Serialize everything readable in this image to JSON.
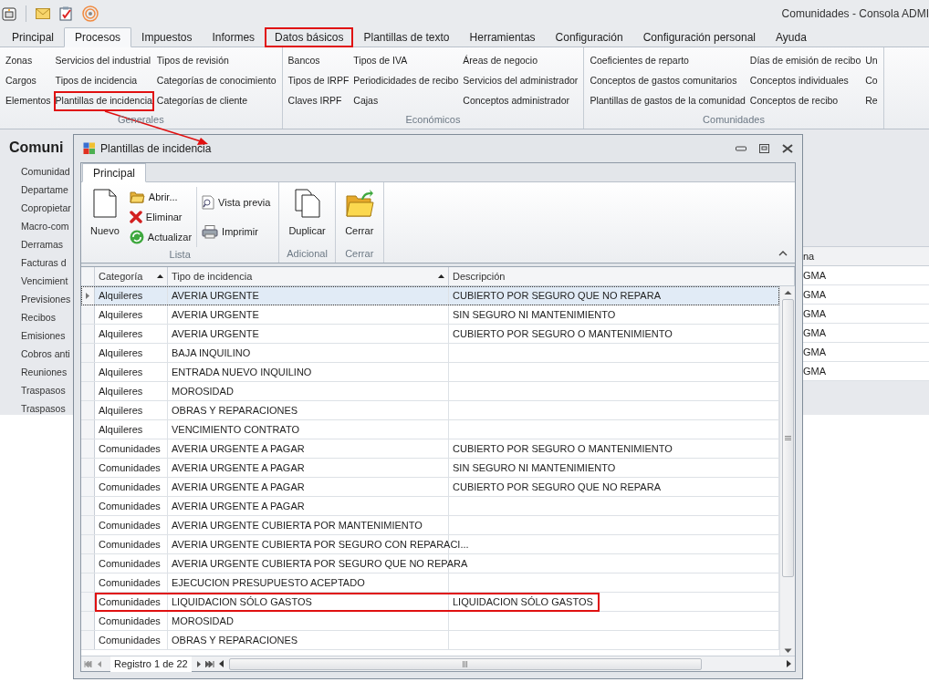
{
  "window": {
    "title": "Comunidades - Consola ADMI"
  },
  "tabs": [
    {
      "label": "Principal",
      "selected": false,
      "highlighted": false
    },
    {
      "label": "Procesos",
      "selected": true,
      "highlighted": false
    },
    {
      "label": "Impuestos",
      "selected": false,
      "highlighted": false
    },
    {
      "label": "Informes",
      "selected": false,
      "highlighted": false
    },
    {
      "label": "Datos básicos",
      "selected": false,
      "highlighted": true
    },
    {
      "label": "Plantillas de texto",
      "selected": false,
      "highlighted": false
    },
    {
      "label": "Herramientas",
      "selected": false,
      "highlighted": false
    },
    {
      "label": "Configuración",
      "selected": false,
      "highlighted": false
    },
    {
      "label": "Configuración personal",
      "selected": false,
      "highlighted": false
    },
    {
      "label": "Ayuda",
      "selected": false,
      "highlighted": false
    }
  ],
  "ribbon": {
    "groups": [
      {
        "label": "Generales",
        "columns": [
          [
            {
              "label": "Zonas",
              "highlighted": false
            },
            {
              "label": "Cargos",
              "highlighted": false
            },
            {
              "label": "Elementos",
              "highlighted": false
            }
          ],
          [
            {
              "label": "Servicios del industrial",
              "highlighted": false
            },
            {
              "label": "Tipos de incidencia",
              "highlighted": false
            },
            {
              "label": "Plantillas de incidencia",
              "highlighted": true
            }
          ],
          [
            {
              "label": "Tipos de revisión",
              "highlighted": false
            },
            {
              "label": "Categorías de conocimiento",
              "highlighted": false
            },
            {
              "label": "Categorías de cliente",
              "highlighted": false
            }
          ]
        ]
      },
      {
        "label": "Económicos",
        "columns": [
          [
            {
              "label": "Bancos",
              "highlighted": false
            },
            {
              "label": "Tipos de IRPF",
              "highlighted": false
            },
            {
              "label": "Claves IRPF",
              "highlighted": false
            }
          ],
          [
            {
              "label": "Tipos de IVA",
              "highlighted": false
            },
            {
              "label": "Periodicidades de recibo",
              "highlighted": false
            },
            {
              "label": "Cajas",
              "highlighted": false
            }
          ],
          [
            {
              "label": "Áreas de negocio",
              "highlighted": false
            },
            {
              "label": "Servicios del administrador",
              "highlighted": false
            },
            {
              "label": "Conceptos administrador",
              "highlighted": false
            }
          ]
        ]
      },
      {
        "label": "Comunidades",
        "columns": [
          [
            {
              "label": "Coeficientes de reparto",
              "highlighted": false
            },
            {
              "label": "Conceptos de gastos comunitarios",
              "highlighted": false
            },
            {
              "label": "Plantillas de gastos de la comunidad",
              "highlighted": false
            }
          ],
          [
            {
              "label": "Días de emisión de recibo",
              "highlighted": false
            },
            {
              "label": "Conceptos individuales",
              "highlighted": false
            },
            {
              "label": "Conceptos de recibo",
              "highlighted": false
            }
          ],
          [
            {
              "label": "Un",
              "highlighted": false
            },
            {
              "label": "Co",
              "highlighted": false
            },
            {
              "label": "Re",
              "highlighted": false
            }
          ]
        ]
      }
    ]
  },
  "side_panel": {
    "title": "Comuni",
    "items": [
      "Comunidad",
      "Departame",
      "Copropietar",
      "Macro-com",
      "Derramas",
      "Facturas d",
      "Vencimient",
      "Previsiones",
      "Recibos",
      "Emisiones",
      "Cobros anti",
      "Reuniones",
      "Traspasos",
      "Traspasos"
    ]
  },
  "background_grid": {
    "column_1": "na",
    "rows": [
      "GMA",
      "GMA",
      "GMA",
      "GMA",
      "GMA",
      "GMA"
    ]
  },
  "dialog": {
    "title": "Plantillas de incidencia",
    "tabs": [
      {
        "label": "Principal",
        "selected": true
      }
    ],
    "groups": [
      {
        "label": "Lista",
        "columns": [
          [
            {
              "label": "Nuevo",
              "kind": "new"
            }
          ],
          [
            {
              "label": "Abrir...",
              "kind": "open"
            },
            {
              "label": "Eliminar",
              "kind": "delete"
            },
            {
              "label": "Actualizar",
              "kind": "refresh"
            }
          ],
          [
            {
              "label": "Vista previa",
              "kind": "preview"
            },
            {
              "label": "Imprimir",
              "kind": "print"
            }
          ]
        ]
      },
      {
        "label": "Adicional",
        "columns": [
          [
            {
              "label": "Duplicar",
              "kind": "duplicate"
            }
          ]
        ]
      },
      {
        "label": "Cerrar",
        "columns": [
          [
            {
              "label": "Cerrar",
              "kind": "close"
            }
          ]
        ]
      }
    ],
    "grid": {
      "columns": [
        {
          "label": "Categoría",
          "sorted": true
        },
        {
          "label": "Tipo de incidencia",
          "sorted": true
        },
        {
          "label": "Descripción",
          "sorted": false
        }
      ],
      "rows": [
        {
          "cells": [
            "Alquileres",
            "AVERIA URGENTE",
            "CUBIERTO POR SEGURO QUE NO REPARA"
          ],
          "selected": true,
          "highlighted": false
        },
        {
          "cells": [
            "Alquileres",
            "AVERIA URGENTE",
            "SIN SEGURO NI MANTENIMIENTO"
          ],
          "selected": false,
          "highlighted": false
        },
        {
          "cells": [
            "Alquileres",
            "AVERIA URGENTE",
            "CUBIERTO POR SEGURO O MANTENIMIENTO"
          ],
          "selected": false,
          "highlighted": false
        },
        {
          "cells": [
            "Alquileres",
            "BAJA INQUILINO"
          ],
          "selected": false,
          "highlighted": false
        },
        {
          "cells": [
            "Alquileres",
            "ENTRADA NUEVO INQUILINO"
          ],
          "selected": false,
          "highlighted": false
        },
        {
          "cells": [
            "Alquileres",
            "MOROSIDAD"
          ],
          "selected": false,
          "highlighted": false
        },
        {
          "cells": [
            "Alquileres",
            "OBRAS Y REPARACIONES"
          ],
          "selected": false,
          "highlighted": false
        },
        {
          "cells": [
            "Alquileres",
            "VENCIMIENTO CONTRATO"
          ],
          "selected": false,
          "highlighted": false
        },
        {
          "cells": [
            "Comunidades",
            "AVERIA URGENTE A PAGAR",
            "CUBIERTO POR SEGURO O MANTENIMIENTO"
          ],
          "selected": false,
          "highlighted": false
        },
        {
          "cells": [
            "Comunidades",
            "AVERIA URGENTE A PAGAR",
            "SIN SEGURO NI MANTENIMIENTO"
          ],
          "selected": false,
          "highlighted": false
        },
        {
          "cells": [
            "Comunidades",
            "AVERIA URGENTE A PAGAR",
            "CUBIERTO POR SEGURO QUE NO REPARA"
          ],
          "selected": false,
          "highlighted": false
        },
        {
          "cells": [
            "Comunidades",
            "AVERIA URGENTE A PAGAR"
          ],
          "selected": false,
          "highlighted": false
        },
        {
          "cells": [
            "Comunidades",
            "AVERIA URGENTE CUBIERTA POR MANTENIMIENTO"
          ],
          "selected": false,
          "highlighted": false
        },
        {
          "cells": [
            "Comunidades",
            "AVERIA URGENTE CUBIERTA POR SEGURO CON REPARACI..."
          ],
          "selected": false,
          "highlighted": false
        },
        {
          "cells": [
            "Comunidades",
            "AVERIA URGENTE CUBIERTA POR SEGURO QUE NO REPARA"
          ],
          "selected": false,
          "highlighted": false
        },
        {
          "cells": [
            "Comunidades",
            "EJECUCION PRESUPUESTO ACEPTADO"
          ],
          "selected": false,
          "highlighted": false
        },
        {
          "cells": [
            "Comunidades",
            "LIQUIDACION SÓLO GASTOS",
            "LIQUIDACION SÓLO GASTOS"
          ],
          "selected": false,
          "highlighted": true
        },
        {
          "cells": [
            "Comunidades",
            "MOROSIDAD"
          ],
          "selected": false,
          "highlighted": false
        },
        {
          "cells": [
            "Comunidades",
            "OBRAS Y REPARACIONES"
          ],
          "selected": false,
          "highlighted": false
        }
      ]
    },
    "footer": {
      "record": "Registro 1 de 22"
    }
  }
}
